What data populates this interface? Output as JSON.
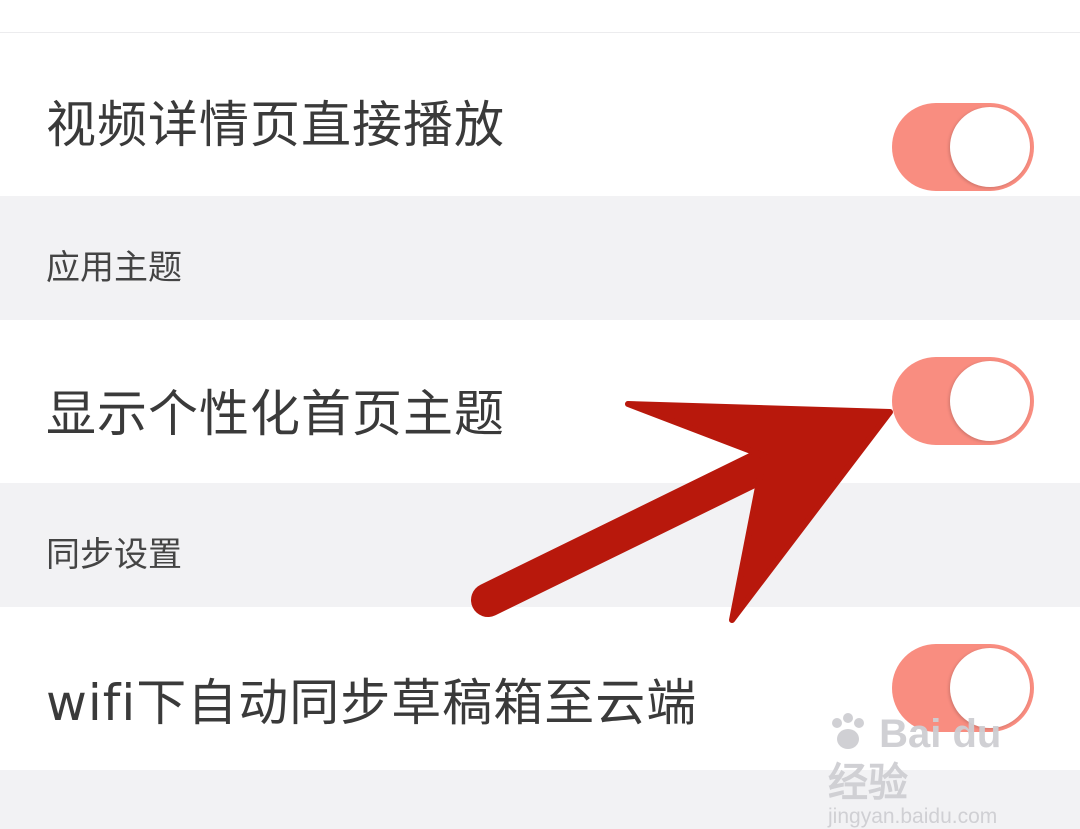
{
  "settings": {
    "video_autoplay": {
      "label": "视频详情页直接播放",
      "enabled": true
    },
    "theme_section": {
      "title": "应用主题"
    },
    "personalized_theme": {
      "label": "显示个性化首页主题",
      "enabled": true
    },
    "sync_section": {
      "title": "同步设置"
    },
    "wifi_sync": {
      "label": "wifi下自动同步草稿箱至云端",
      "enabled": true
    }
  },
  "colors": {
    "toggle_on": "#f98d80",
    "arrow": "#b8180c",
    "section_bg": "#f2f2f4",
    "row_bg": "#ffffff"
  },
  "watermark": {
    "brand": "Bai du 经验",
    "url": "jingyan.baidu.com"
  },
  "icons": {
    "watermark_logo": "paw-icon",
    "annotation": "arrow-annotation"
  }
}
